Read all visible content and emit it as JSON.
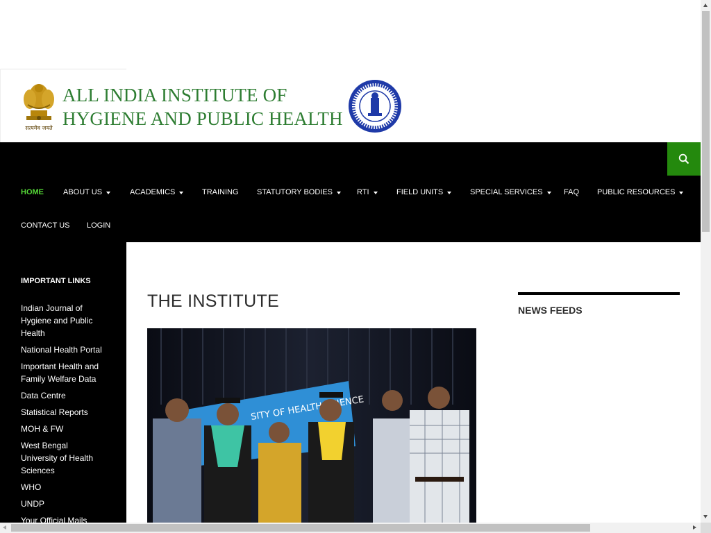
{
  "header": {
    "title_line1": "ALL INDIA INSTITUTE OF",
    "title_line2": "HYGIENE AND PUBLIC HEALTH",
    "emblem_icon": "state-emblem-icon",
    "emblem_motto": "सत्यमेव जयते",
    "seal_icon": "institute-seal-icon",
    "title_color": "#2e7d32"
  },
  "search": {
    "icon": "search-icon",
    "color": "#24890d"
  },
  "nav": {
    "items": [
      {
        "label": "HOME",
        "active": true,
        "dropdown": false
      },
      {
        "label": "ABOUT US",
        "active": false,
        "dropdown": true
      },
      {
        "label": "ACADEMICS",
        "active": false,
        "dropdown": true
      },
      {
        "label": "TRAINING",
        "active": false,
        "dropdown": false
      },
      {
        "label": "STATUTORY BODIES",
        "active": false,
        "dropdown": true
      },
      {
        "label": "RTI",
        "active": false,
        "dropdown": true
      },
      {
        "label": "FIELD UNITS",
        "active": false,
        "dropdown": true
      },
      {
        "label": "SPECIAL SERVICES",
        "active": false,
        "dropdown": true
      },
      {
        "label": "FAQ",
        "active": false,
        "dropdown": false
      },
      {
        "label": "PUBLIC RESOURCES",
        "active": false,
        "dropdown": true
      },
      {
        "label": "CONTACT US",
        "active": false,
        "dropdown": false
      },
      {
        "label": "LOGIN",
        "active": false,
        "dropdown": false
      }
    ],
    "active_color": "#55d737"
  },
  "sidebar": {
    "heading": "IMPORTANT LINKS",
    "links": [
      "Indian Journal of Hygiene and Public Health",
      "National Health Portal",
      "Important Health and Family Welfare Data",
      "Data Centre",
      "Statistical Reports",
      "MOH & FW",
      "West Bengal University of Health Sciences",
      "WHO",
      "UNDP",
      "Your Official Mails"
    ]
  },
  "main": {
    "title": "THE INSTITUTE",
    "photo_banner_text": "SITY OF HEALTH SCIENCE"
  },
  "widgets": {
    "news_title": "NEWS FEEDS"
  }
}
